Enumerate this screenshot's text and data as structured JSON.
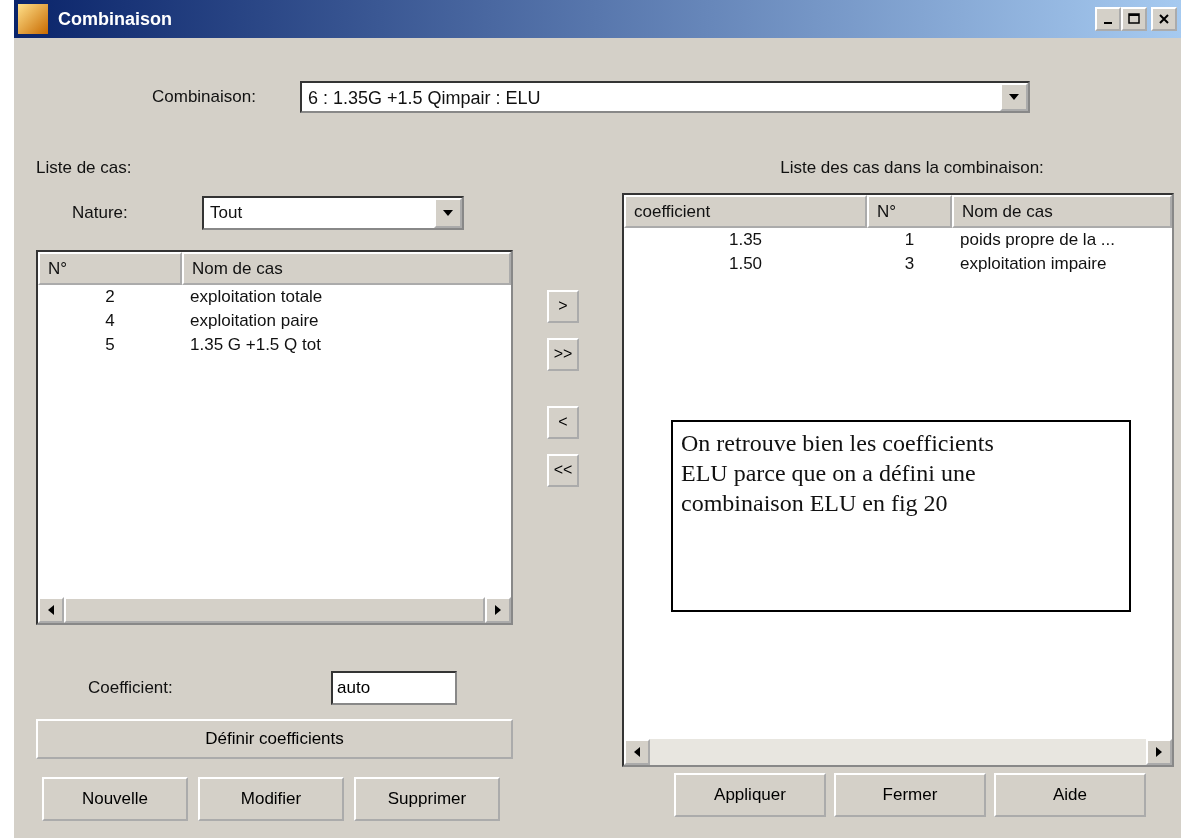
{
  "window": {
    "title": "Combinaison"
  },
  "combination": {
    "label": "Combinaison:",
    "value": "6 : 1.35G +1.5 Qimpair : ELU"
  },
  "left_panel": {
    "title": "Liste de cas:",
    "nature": {
      "label": "Nature:",
      "value": "Tout"
    },
    "list": {
      "columns": [
        "N°",
        "Nom de cas"
      ],
      "rows": [
        [
          "2",
          "exploitation totale"
        ],
        [
          "4",
          "exploitation paire"
        ],
        [
          "5",
          "1.35 G +1.5 Q tot"
        ]
      ]
    },
    "coefficient": {
      "label": "Coefficient:",
      "value": "auto"
    },
    "define_button": "Définir coefficients"
  },
  "transfer_buttons": [
    ">",
    ">>",
    "<",
    "<<"
  ],
  "right_panel": {
    "title": "Liste des cas dans la combinaison:",
    "list": {
      "columns": [
        "coefficient",
        "N°",
        "Nom de cas"
      ],
      "rows": [
        [
          "1.35",
          "1",
          "poids propre de la ..."
        ],
        [
          "1.50",
          "3",
          "exploitation impaire"
        ]
      ]
    }
  },
  "annotation": {
    "text": "On retrouve bien les coefficients ELU parce que on a défini une combinaison ELU en fig 20"
  },
  "buttons_left": [
    "Nouvelle",
    "Modifier",
    "Supprimer"
  ],
  "buttons_right": [
    "Appliquer",
    "Fermer",
    "Aide"
  ]
}
